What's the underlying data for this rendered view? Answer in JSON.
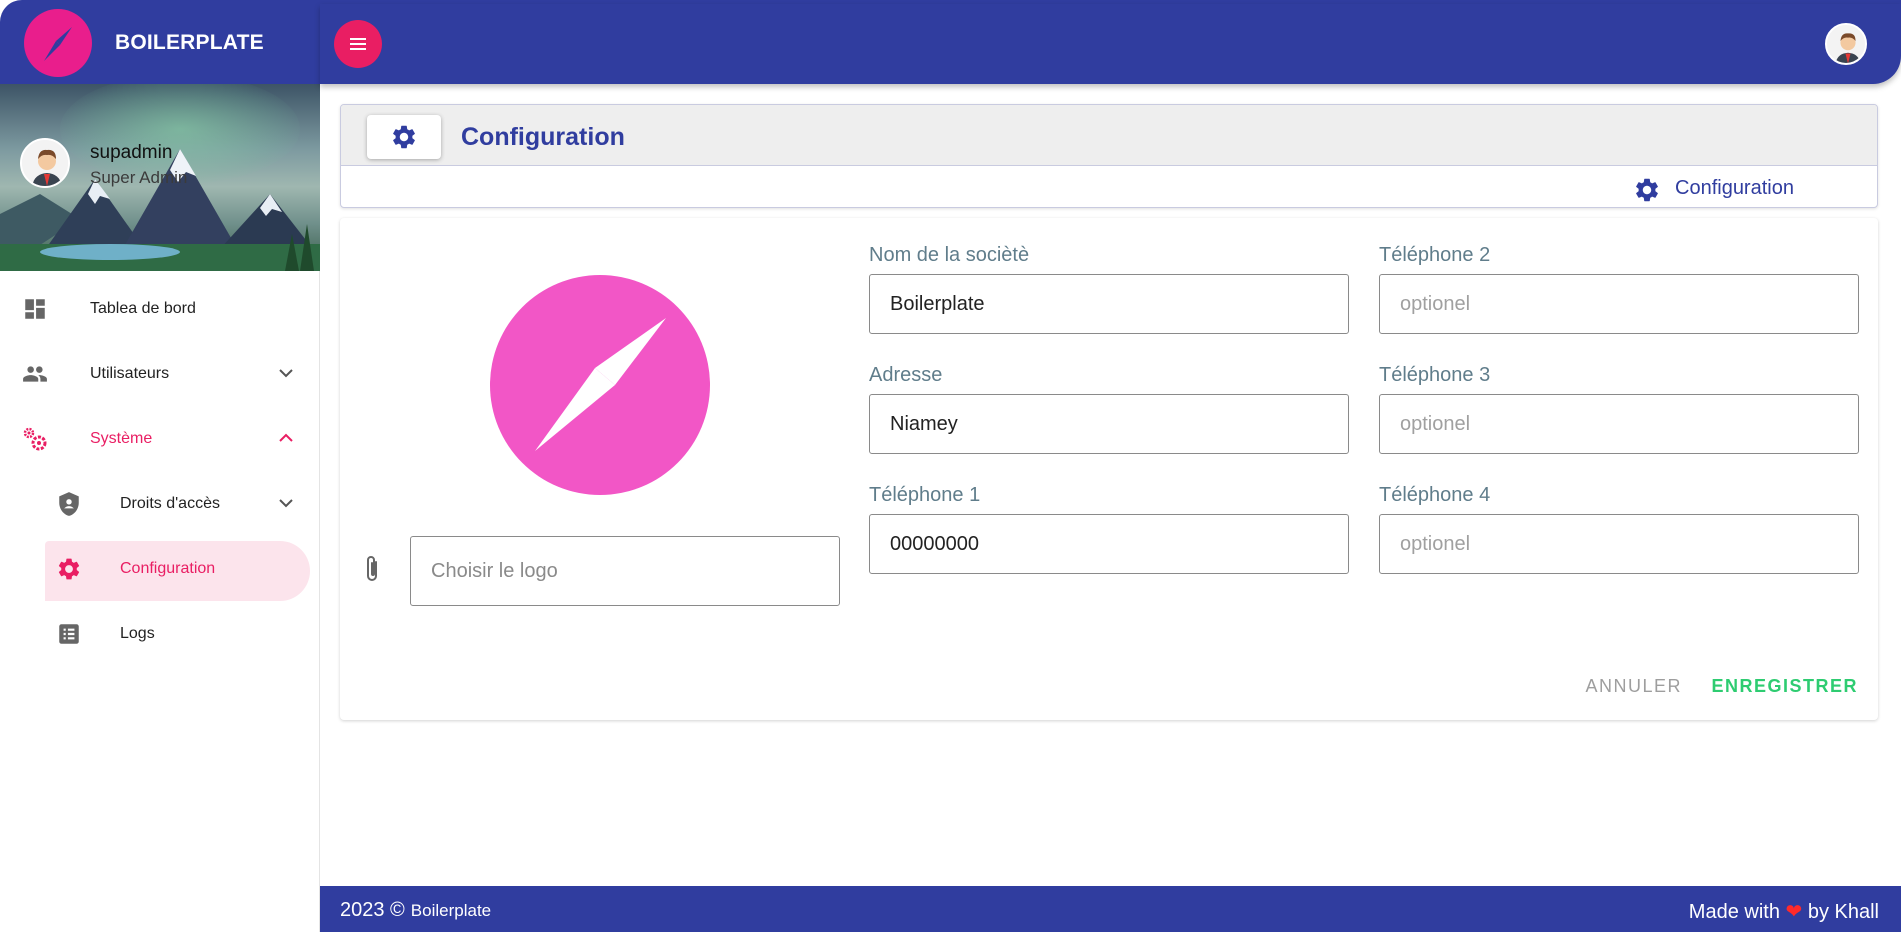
{
  "brand": {
    "name": "BOILERPLATE"
  },
  "user": {
    "name": "supadmin",
    "role": "Super Admin"
  },
  "sidebar": {
    "items": [
      {
        "label": "Tablea de bord",
        "icon": "dashboard-icon"
      },
      {
        "label": "Utilisateurs",
        "icon": "users-icon"
      },
      {
        "label": "Système",
        "icon": "system-gears-icon"
      },
      {
        "label": "Droits d'accès",
        "icon": "shield-icon"
      },
      {
        "label": "Configuration",
        "icon": "gear-icon"
      },
      {
        "label": "Logs",
        "icon": "list-icon"
      }
    ]
  },
  "header": {
    "title": "Configuration",
    "breadcrumb": "Configuration"
  },
  "form": {
    "logo_placeholder": "Choisir le logo",
    "company_label": "Nom de la sociètè",
    "company_value": "Boilerplate",
    "address_label": "Adresse",
    "address_value": "Niamey",
    "phone1_label": "Téléphone 1",
    "phone1_value": "00000000",
    "phone2_label": "Téléphone 2",
    "phone2_placeholder": "optionel",
    "phone3_label": "Téléphone 3",
    "phone3_placeholder": "optionel",
    "phone4_label": "Téléphone 4",
    "phone4_placeholder": "optionel",
    "cancel_label": "ANNULER",
    "save_label": "ENREGISTRER"
  },
  "footer": {
    "copyright": "2023 ©",
    "brand": "Boilerplate",
    "made_with": "Made with",
    "heart": "❤",
    "by": "by Khall"
  },
  "colors": {
    "primary": "#303d9f",
    "accent": "#e91e63",
    "logo": "#f256c6",
    "save": "#2ecc71"
  }
}
